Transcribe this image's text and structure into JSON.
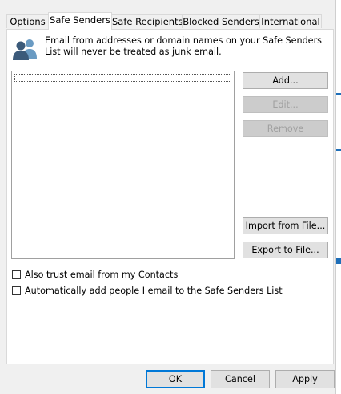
{
  "tabs": [
    {
      "label": "Options"
    },
    {
      "label": "Safe Senders"
    },
    {
      "label": "Safe Recipients"
    },
    {
      "label": "Blocked Senders"
    },
    {
      "label": "International"
    }
  ],
  "active_tab": "Safe Senders",
  "info": {
    "icon": "people-icon",
    "text": "Email from addresses or domain names on your Safe Senders List will never be treated as junk email."
  },
  "list": {
    "items": []
  },
  "side_buttons": {
    "add": "Add...",
    "edit": "Edit...",
    "remove": "Remove",
    "import": "Import from File...",
    "export": "Export to File..."
  },
  "checkboxes": {
    "trust_contacts": {
      "label": "Also trust email from my Contacts",
      "checked": false
    },
    "auto_add": {
      "label": "Automatically add people I email to the Safe Senders List",
      "checked": false
    }
  },
  "dialog_buttons": {
    "ok": "OK",
    "cancel": "Cancel",
    "apply": "Apply"
  },
  "colors": {
    "accent": "#0078d7",
    "icon_dark": "#3b5a7a",
    "icon_light": "#6a9bc3"
  }
}
